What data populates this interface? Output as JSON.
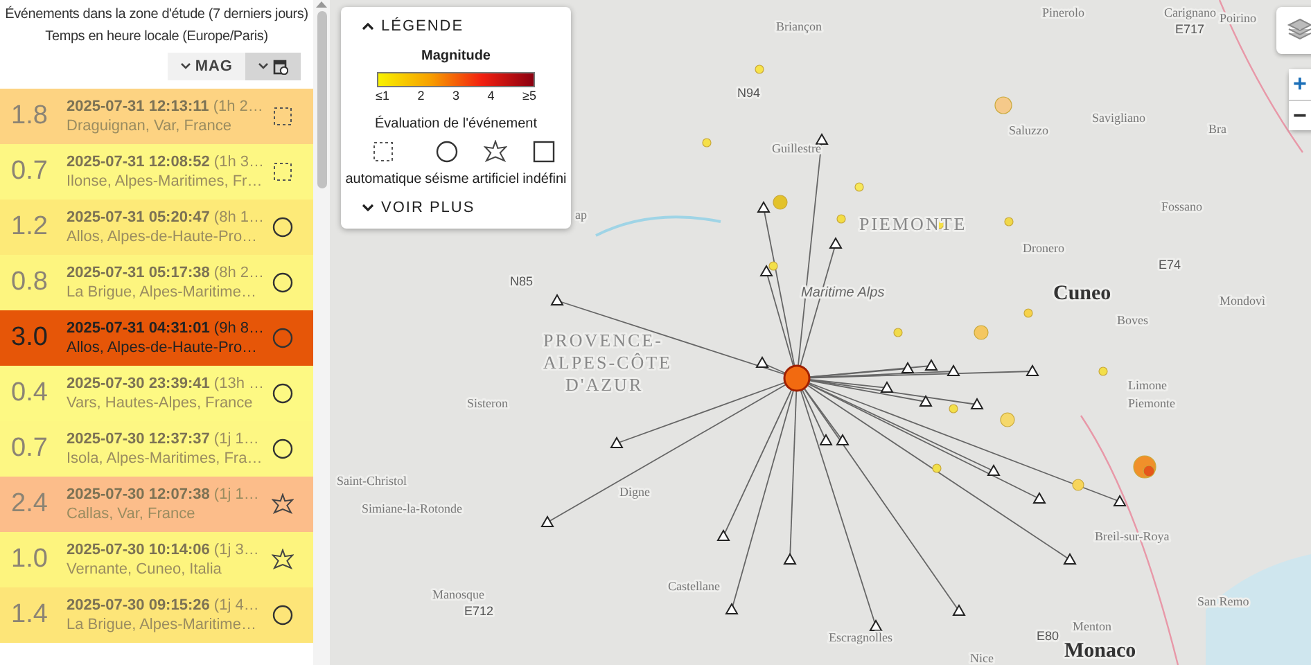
{
  "panel": {
    "title": "Événements dans la zone d'étude (7 derniers jours)",
    "subtitle": "Temps en heure locale (Europe/Paris)",
    "sort_buttons": [
      {
        "kind": "mag",
        "label": "MAG",
        "selected": false
      },
      {
        "kind": "date",
        "selected": true
      }
    ]
  },
  "events": [
    {
      "magnitude": "1.8",
      "time": "2025-07-31 12:13:11",
      "age": "(1h 2…",
      "place": "Draguignan, Var, France",
      "kind": "automatique",
      "color": "#fdd382",
      "selected": false
    },
    {
      "magnitude": "0.7",
      "time": "2025-07-31 12:08:52",
      "age": "(1h 3…",
      "place": "Ilonse, Alpes-Maritimes, Fr…",
      "kind": "automatique",
      "color": "#fdf783",
      "selected": false
    },
    {
      "magnitude": "1.2",
      "time": "2025-07-31 05:20:47",
      "age": "(8h 1…",
      "place": "Allos, Alpes-de-Haute-Pro…",
      "kind": "seisme",
      "color": "#fdea78",
      "selected": false
    },
    {
      "magnitude": "0.8",
      "time": "2025-07-31 05:17:38",
      "age": "(8h 2…",
      "place": "La Brigue, Alpes-Maritime…",
      "kind": "seisme",
      "color": "#fdf57f",
      "selected": false
    },
    {
      "magnitude": "3.0",
      "time": "2025-07-31 04:31:01",
      "age": "(9h 8…",
      "place": "Allos, Alpes-de-Haute-Pro…",
      "kind": "seisme",
      "color": "#e65608",
      "selected": true
    },
    {
      "magnitude": "0.4",
      "time": "2025-07-30 23:39:41",
      "age": "(13h …",
      "place": "Vars, Hautes-Alpes, France",
      "kind": "seisme",
      "color": "#fdf983",
      "selected": false
    },
    {
      "magnitude": "0.7",
      "time": "2025-07-30 12:37:37",
      "age": "(1j 1…",
      "place": "Isola, Alpes-Maritimes, Fra…",
      "kind": "seisme",
      "color": "#fdf783",
      "selected": false
    },
    {
      "magnitude": "2.4",
      "time": "2025-07-30 12:07:38",
      "age": "(1j 1…",
      "place": "Callas, Var, France",
      "kind": "artificiel",
      "color": "#fcbd8a",
      "selected": false
    },
    {
      "magnitude": "1.0",
      "time": "2025-07-30 10:14:06",
      "age": "(1j 3…",
      "place": "Vernante, Cuneo, Italia",
      "kind": "artificiel",
      "color": "#fdf47e",
      "selected": false
    },
    {
      "magnitude": "1.4",
      "time": "2025-07-30 09:15:26",
      "age": "(1j 4…",
      "place": "La Brigue, Alpes-Maritime…",
      "kind": "seisme",
      "color": "#fde578",
      "selected": false
    }
  ],
  "legend": {
    "title": "LÉGENDE",
    "expanded": true,
    "magnitude_title": "Magnitude",
    "scale_labels": [
      "≤1",
      "2",
      "3",
      "4",
      "≥5"
    ],
    "evaluation_title": "Évaluation de l'événement",
    "evaluations": [
      {
        "kind": "automatique",
        "label": "automatique"
      },
      {
        "kind": "seisme",
        "label": "séisme"
      },
      {
        "kind": "artificiel",
        "label": "artificiel"
      },
      {
        "kind": "indefini",
        "label": "indéfini"
      }
    ],
    "more": "VOIR PLUS"
  },
  "map": {
    "labels": [
      {
        "kind": "town",
        "text": "Briançon"
      },
      {
        "kind": "town",
        "text": "Pinerolo"
      },
      {
        "kind": "town",
        "text": "Carignano"
      },
      {
        "kind": "town",
        "text": "Poirino"
      },
      {
        "kind": "road",
        "text": "N94"
      },
      {
        "kind": "road",
        "text": "E717"
      },
      {
        "kind": "town",
        "text": "Guillestre"
      },
      {
        "kind": "town",
        "text": "Saluzzo"
      },
      {
        "kind": "town",
        "text": "Savigliano"
      },
      {
        "kind": "town",
        "text": "Bra"
      },
      {
        "kind": "town",
        "text": "Fossano"
      },
      {
        "kind": "region",
        "text": "PIEMONTE"
      },
      {
        "kind": "town",
        "text": "Dronero"
      },
      {
        "kind": "road",
        "text": "E74"
      },
      {
        "kind": "city",
        "text": "Cuneo"
      },
      {
        "kind": "town",
        "text": "Mondovì"
      },
      {
        "kind": "road",
        "text": "N85"
      },
      {
        "kind": "area",
        "text": "Maritime Alps"
      },
      {
        "kind": "town",
        "text": "Boves"
      },
      {
        "kind": "town",
        "text": "ap"
      },
      {
        "kind": "region",
        "text": "PROVENCE-"
      },
      {
        "kind": "region",
        "text": "ALPES-CÔTE"
      },
      {
        "kind": "region",
        "text": "D'AZUR"
      },
      {
        "kind": "town",
        "text": "Sisteron"
      },
      {
        "kind": "town",
        "text": "Limone"
      },
      {
        "kind": "town",
        "text": "Piemonte"
      },
      {
        "kind": "town",
        "text": "Digne"
      },
      {
        "kind": "town",
        "text": "Saint-Christol"
      },
      {
        "kind": "town",
        "text": "Simiane-la-Rotonde"
      },
      {
        "kind": "town",
        "text": "Breil-sur-Roya"
      },
      {
        "kind": "town",
        "text": "San Remo"
      },
      {
        "kind": "town",
        "text": "Manosque"
      },
      {
        "kind": "road",
        "text": "E712"
      },
      {
        "kind": "town",
        "text": "Castellane"
      },
      {
        "kind": "town",
        "text": "Menton"
      },
      {
        "kind": "road",
        "text": "E80"
      },
      {
        "kind": "town",
        "text": "Escragnolles"
      },
      {
        "kind": "city",
        "text": "Monaco"
      },
      {
        "kind": "town",
        "text": "Nice"
      }
    ],
    "zoom_in": "+",
    "zoom_out": "−"
  }
}
